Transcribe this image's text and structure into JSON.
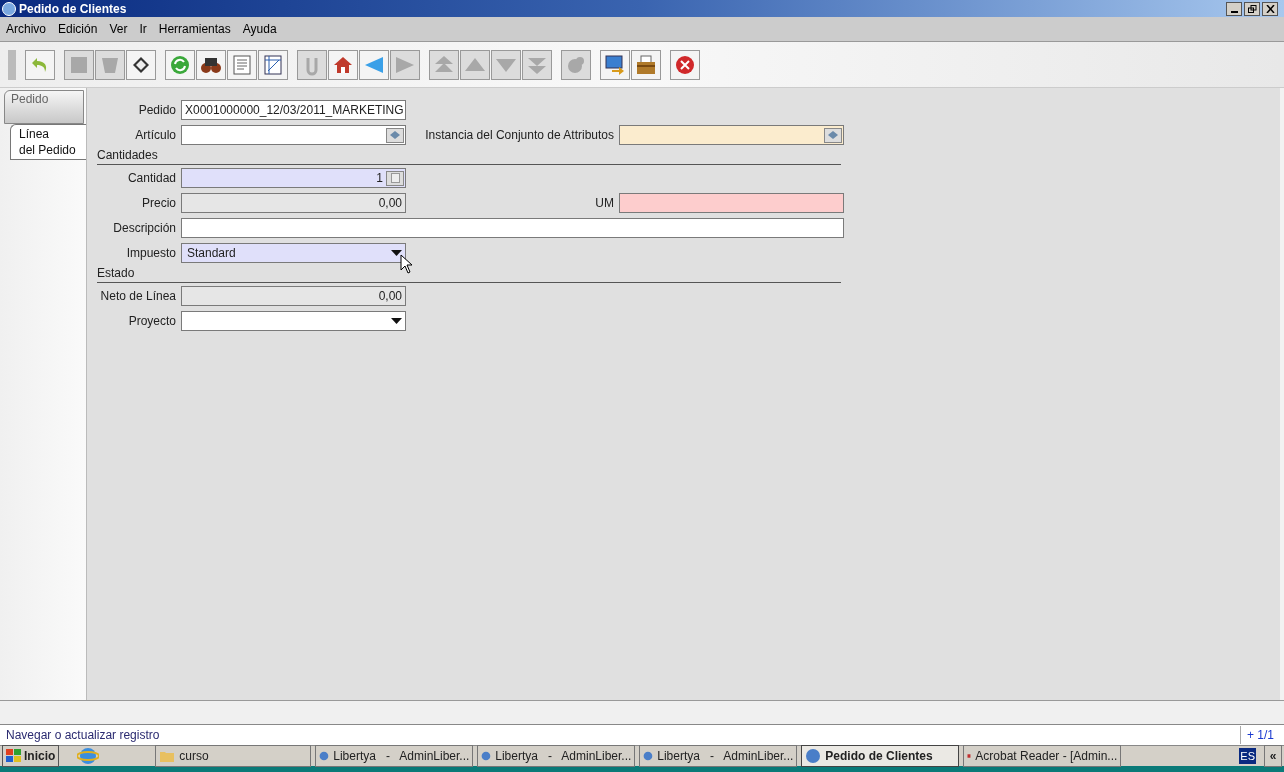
{
  "window": {
    "title": "Pedido de Clientes"
  },
  "menu": [
    "Archivo",
    "Edición",
    "Ver",
    "Ir",
    "Herramientas",
    "Ayuda"
  ],
  "toolbar": [
    [
      {
        "kind": "undo",
        "disabled": false
      }
    ],
    [
      {
        "kind": "new",
        "disabled": true
      },
      {
        "kind": "delete",
        "disabled": true
      },
      {
        "kind": "save",
        "disabled": false
      }
    ],
    [
      {
        "kind": "refresh",
        "disabled": false
      },
      {
        "kind": "find",
        "disabled": false
      },
      {
        "kind": "report",
        "disabled": false
      },
      {
        "kind": "grid",
        "disabled": false
      }
    ],
    [
      {
        "kind": "attach",
        "disabled": true
      },
      {
        "kind": "home",
        "disabled": false
      },
      {
        "kind": "left",
        "disabled": false
      },
      {
        "kind": "right",
        "disabled": true
      }
    ],
    [
      {
        "kind": "first",
        "disabled": true
      },
      {
        "kind": "up",
        "disabled": true
      },
      {
        "kind": "down",
        "disabled": true
      },
      {
        "kind": "last",
        "disabled": true
      }
    ],
    [
      {
        "kind": "chat",
        "disabled": true
      }
    ],
    [
      {
        "kind": "export",
        "disabled": false
      },
      {
        "kind": "archive",
        "disabled": false
      }
    ],
    [
      {
        "kind": "close",
        "disabled": false
      }
    ]
  ],
  "tabs": [
    {
      "label": "Pedido",
      "selected": false
    },
    {
      "label": "Línea\ndel Pedido",
      "selected": true
    }
  ],
  "form": [
    {
      "kind": "row",
      "fields": [
        {
          "label": "Pedido",
          "kind": "text",
          "value": "X0001000000_12/03/2011_MARKETING",
          "color": "#ffffff"
        }
      ]
    },
    {
      "kind": "row",
      "fields": [
        {
          "label": "Artículo",
          "kind": "lookup",
          "color": "#ffffff"
        },
        {
          "label": "Instancia del Conjunto de Attributos",
          "kind": "lookup",
          "color": "#fbecce"
        }
      ]
    },
    {
      "kind": "section",
      "label": "Cantidades"
    },
    {
      "kind": "row",
      "fields": [
        {
          "label": "Cantidad",
          "kind": "number",
          "value": "1",
          "color": "#e0e0fa"
        }
      ]
    },
    {
      "kind": "row",
      "fields": [
        {
          "label": "Precio",
          "kind": "amount",
          "value": "0,00",
          "color": "#e6e6e6"
        },
        {
          "label": "UM",
          "kind": "text",
          "color": "#fdcdcd"
        }
      ]
    },
    {
      "kind": "row",
      "fields": [
        {
          "label": "Descripción",
          "kind": "wide",
          "color": "#ffffff"
        }
      ]
    },
    {
      "kind": "row",
      "fields": [
        {
          "label": "Impuesto",
          "kind": "select",
          "value": "Standard",
          "color": "#e0e0fa"
        }
      ]
    },
    {
      "kind": "section",
      "label": "Estado"
    },
    {
      "kind": "row",
      "fields": [
        {
          "label": "Neto de Línea",
          "kind": "amount",
          "value": "0,00",
          "color": "#e6e6e6"
        }
      ]
    },
    {
      "kind": "row",
      "fields": [
        {
          "label": "Proyecto",
          "kind": "select",
          "color": "#ffffff"
        }
      ]
    }
  ],
  "status_bar": {
    "message": "Navegar o actualizar registro",
    "record": "+ 1/1"
  },
  "taskbar": {
    "start": "Inicio",
    "items": [
      {
        "label": "curso",
        "kind": "folder",
        "selected": false
      },
      {
        "label": "Libertya   -   AdminLiber...",
        "kind": "globe",
        "selected": false
      },
      {
        "label": "Libertya   -   AdminLiber...",
        "kind": "globe",
        "selected": false
      },
      {
        "label": "Libertya   -   AdminLiber...",
        "kind": "globe",
        "selected": false
      },
      {
        "label": "Pedido de Clientes",
        "kind": "globe",
        "selected": true
      },
      {
        "label": "Acrobat Reader - [Admin...",
        "kind": "pdf",
        "selected": false
      }
    ],
    "language": "ES",
    "expand": "«"
  }
}
